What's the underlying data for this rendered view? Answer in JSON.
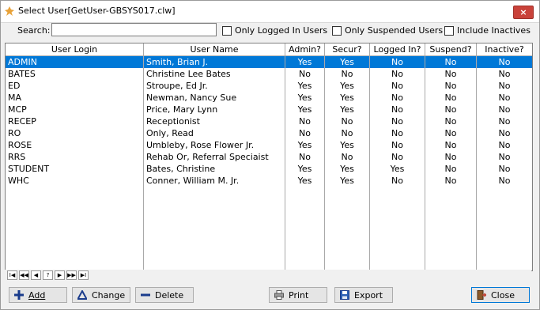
{
  "window": {
    "title": "Select User[GetUser-GBSYS017.clw]",
    "close_symbol": "×"
  },
  "search": {
    "label": "Search:",
    "value": "",
    "placeholder": ""
  },
  "filters": [
    {
      "label": "Only Logged In Users",
      "checked": false
    },
    {
      "label": "Only Suspended Users",
      "checked": false
    },
    {
      "label": "Include Inactives",
      "checked": false
    }
  ],
  "table": {
    "columns": [
      "User Login",
      "User Name",
      "Admin?",
      "Secur?",
      "Logged In?",
      "Suspend?",
      "Inactive?"
    ],
    "rows": [
      [
        "ADMIN",
        "Smith, Brian J.",
        "Yes",
        "Yes",
        "No",
        "No",
        "No"
      ],
      [
        "BATES",
        "Christine Lee Bates",
        "No",
        "No",
        "No",
        "No",
        "No"
      ],
      [
        "ED",
        "Stroupe, Ed  Jr.",
        "Yes",
        "Yes",
        "No",
        "No",
        "No"
      ],
      [
        "MA",
        "Newman, Nancy Sue",
        "Yes",
        "Yes",
        "No",
        "No",
        "No"
      ],
      [
        "MCP",
        "Price, Mary Lynn",
        "Yes",
        "Yes",
        "No",
        "No",
        "No"
      ],
      [
        "RECEP",
        "Receptionist",
        "No",
        "No",
        "No",
        "No",
        "No"
      ],
      [
        "RO",
        "Only, Read",
        "No",
        "No",
        "No",
        "No",
        "No"
      ],
      [
        "ROSE",
        "Umbleby, Rose Flower Jr.",
        "Yes",
        "Yes",
        "No",
        "No",
        "No"
      ],
      [
        "RRS",
        "Rehab Or, Referral Speciaist",
        "No",
        "No",
        "No",
        "No",
        "No"
      ],
      [
        "STUDENT",
        "Bates, Christine",
        "Yes",
        "Yes",
        "Yes",
        "No",
        "No"
      ],
      [
        "WHC",
        "Conner, William M. Jr.",
        "Yes",
        "Yes",
        "No",
        "No",
        "No"
      ]
    ],
    "selected_row": 0
  },
  "nav_buttons": [
    {
      "name": "first-page",
      "glyph": "I◀"
    },
    {
      "name": "prev-page",
      "glyph": "◀◀"
    },
    {
      "name": "prev-record",
      "glyph": "◀"
    },
    {
      "name": "locate",
      "glyph": "?"
    },
    {
      "name": "next-record",
      "glyph": "▶"
    },
    {
      "name": "next-page",
      "glyph": "▶▶"
    },
    {
      "name": "last-page",
      "glyph": "▶I"
    }
  ],
  "buttons": {
    "add": "Add",
    "change": "Change",
    "delete": "Delete",
    "print": "Print",
    "export": "Export",
    "close": "Close"
  },
  "colors": {
    "selection": "#0078d7",
    "close_button": "#c9423a"
  }
}
